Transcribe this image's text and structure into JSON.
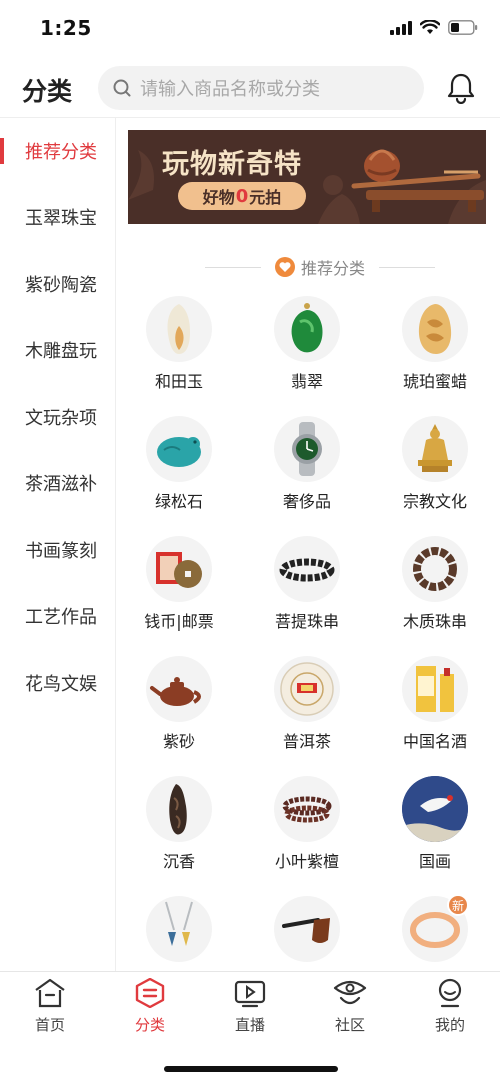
{
  "status_bar": {
    "time": "1:25"
  },
  "header": {
    "title": "分类",
    "search_placeholder": "请输入商品名称或分类"
  },
  "sidebar": {
    "items": [
      {
        "label": "推荐分类",
        "active": true
      },
      {
        "label": "玉翠珠宝",
        "active": false
      },
      {
        "label": "紫砂陶瓷",
        "active": false
      },
      {
        "label": "木雕盘玩",
        "active": false
      },
      {
        "label": "文玩杂项",
        "active": false
      },
      {
        "label": "茶酒滋补",
        "active": false
      },
      {
        "label": "书画篆刻",
        "active": false
      },
      {
        "label": "工艺作品",
        "active": false
      },
      {
        "label": "花鸟文娱",
        "active": false
      }
    ]
  },
  "banner": {
    "title": "玩物新奇特",
    "pill_prefix": "好物",
    "pill_zero": "0",
    "pill_suffix": "元拍"
  },
  "section": {
    "heading": "推荐分类"
  },
  "categories": [
    {
      "label": "和田玉",
      "icon": "hetian-jade-icon"
    },
    {
      "label": "翡翠",
      "icon": "jadeite-pendant-icon"
    },
    {
      "label": "琥珀蜜蜡",
      "icon": "amber-icon"
    },
    {
      "label": "绿松石",
      "icon": "turquoise-icon"
    },
    {
      "label": "奢侈品",
      "icon": "watch-icon"
    },
    {
      "label": "宗教文化",
      "icon": "buddha-statue-icon"
    },
    {
      "label": "钱币|邮票",
      "icon": "coin-stamp-icon"
    },
    {
      "label": "菩提珠串",
      "icon": "bodhi-bracelet-icon"
    },
    {
      "label": "木质珠串",
      "icon": "wood-bead-bracelet-icon"
    },
    {
      "label": "紫砂",
      "icon": "teapot-icon"
    },
    {
      "label": "普洱茶",
      "icon": "puer-tea-cake-icon"
    },
    {
      "label": "中国名酒",
      "icon": "liquor-bottle-icon"
    },
    {
      "label": "沉香",
      "icon": "agarwood-icon"
    },
    {
      "label": "小叶紫檀",
      "icon": "sandalwood-beads-icon"
    },
    {
      "label": "国画",
      "icon": "chinese-painting-icon"
    },
    {
      "label": "",
      "icon": "pendant-jewelry-icon"
    },
    {
      "label": "",
      "icon": "tobacco-pipe-icon"
    },
    {
      "label": "",
      "icon": "bangle-icon",
      "badge": "新"
    }
  ],
  "tabbar": {
    "tabs": [
      {
        "label": "首页",
        "icon": "home-icon",
        "active": false
      },
      {
        "label": "分类",
        "icon": "category-icon",
        "active": true
      },
      {
        "label": "直播",
        "icon": "live-icon",
        "active": false
      },
      {
        "label": "社区",
        "icon": "community-icon",
        "active": false
      },
      {
        "label": "我的",
        "icon": "profile-icon",
        "active": false
      }
    ]
  },
  "colors": {
    "accent": "#e03a3e",
    "banner_bg": "#4a2f28",
    "banner_pill": "#f1c08e"
  }
}
